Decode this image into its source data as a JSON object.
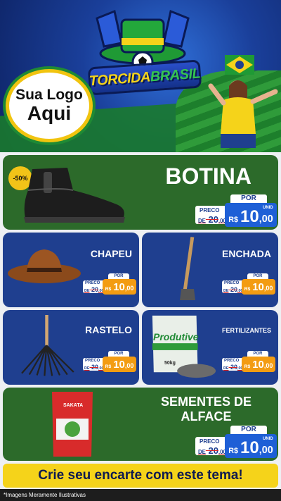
{
  "header": {
    "logo_line1": "Sua Logo",
    "logo_line2": "Aqui",
    "brand_part1": "TORCIDA",
    "brand_part2": "BRASIL"
  },
  "products": [
    {
      "name": "BOTINA",
      "badge": "-50%",
      "por": "POR",
      "preco": "PRECO",
      "old_prefix": "DE",
      "old_int": "20",
      "old_cents": "00",
      "rs": "R$",
      "new_int": "10",
      "new_cents": ",00",
      "unid": "UNID",
      "image": "boot-icon"
    },
    {
      "name": "CHAPEU",
      "por": "POR",
      "preco": "PRECO",
      "old_prefix": "DE",
      "old_int": "20",
      "old_cents": "00",
      "rs": "R$",
      "new_int": "10",
      "new_cents": ",00",
      "unid": "UNID",
      "image": "hat-icon"
    },
    {
      "name": "ENCHADA",
      "por": "POR",
      "preco": "PRECO",
      "old_prefix": "DE",
      "old_int": "20",
      "old_cents": "00",
      "rs": "R$",
      "new_int": "10",
      "new_cents": ",00",
      "unid": "UNID",
      "image": "hoe-icon"
    },
    {
      "name": "RASTELO",
      "por": "POR",
      "preco": "PRECO",
      "old_prefix": "DE",
      "old_int": "20",
      "old_cents": "00",
      "rs": "R$",
      "new_int": "10",
      "new_cents": ",00",
      "unid": "UNID",
      "image": "rake-icon"
    },
    {
      "name": "FERTILIZANTES",
      "por": "POR",
      "preco": "PRECO",
      "old_prefix": "DE",
      "old_int": "20",
      "old_cents": "00",
      "rs": "R$",
      "new_int": "10",
      "new_cents": ",00",
      "unid": "UNID",
      "image": "fertilizer-bag-icon",
      "bag_brand": "Produtive",
      "bag_weight": "50kg"
    },
    {
      "name_line1": "SEMENTES DE",
      "name_line2": "ALFACE",
      "por": "POR",
      "preco": "PRECO",
      "old_prefix": "DE",
      "old_int": "20",
      "old_cents": "00",
      "rs": "R$",
      "new_int": "10",
      "new_cents": ",00",
      "unid": "UNID",
      "image": "seed-packet-icon",
      "packet_brand": "SAKATA"
    }
  ],
  "cta": "Crie seu encarte com este tema!",
  "footnote": "*Imagens Meramente Ilustrativas",
  "colors": {
    "green": "#2c6a2a",
    "blue": "#1f3f8f",
    "yellow": "#f5d31a",
    "price_blue": "#1e5fd6",
    "price_orange": "#f39c12"
  }
}
